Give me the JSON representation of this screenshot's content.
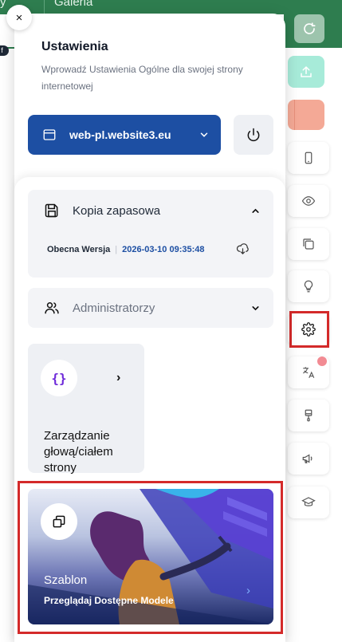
{
  "background": {
    "tab_fragment_left": "y",
    "tab_label": "Galeria",
    "badge_text": "f"
  },
  "panel": {
    "close_symbol": "×",
    "title": "Ustawienia",
    "description": "Wprowadź Ustawienia Ogólne dla swojej strony internetowej",
    "site_selector": {
      "value": "web-pl.website3.eu",
      "icon": "browser-window-icon"
    },
    "power_icon": "power-icon"
  },
  "backup": {
    "title": "Kopia zapasowa",
    "current_version_label": "Obecna Wersja",
    "separator": "|",
    "current_version_date": "2026-03-10 09:35:48",
    "icon": "floppy-disk-icon",
    "download_icon": "cloud-download-icon"
  },
  "admins": {
    "title": "Administratorzy",
    "icon": "users-icon"
  },
  "head_body": {
    "icon_text": "{}",
    "label": "Zarządzanie głową/ciałem strony"
  },
  "template": {
    "title": "Szablon",
    "subtitle": "Przeglądaj Dostępne Modele",
    "icon": "layers-icon"
  },
  "rail": [
    "refresh-icon",
    "upload-icon",
    "mobile-icon",
    "eye-icon",
    "pages-icon",
    "bulb-icon",
    "gear-icon",
    "translate-icon",
    "brush-icon",
    "megaphone-icon",
    "graduation-cap-icon"
  ],
  "colors": {
    "primary": "#1d4fa3",
    "green": "#2e7d4f",
    "highlight_red": "#d42a2a",
    "card_bg": "#f3f4f7",
    "mint": "#a7ebd9",
    "salmon": "#f4a996"
  }
}
